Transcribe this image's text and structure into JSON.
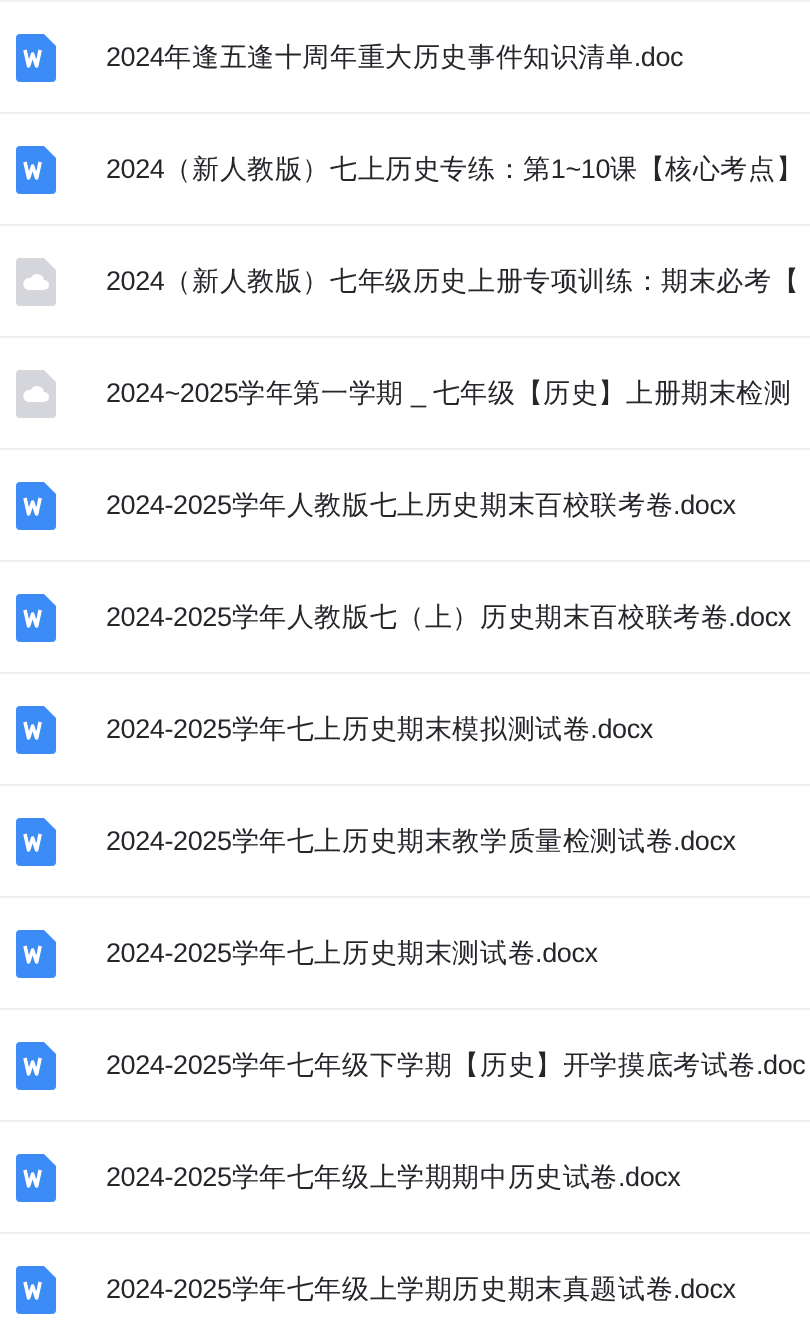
{
  "files": [
    {
      "kind": "word",
      "name": "2024年逢五逢十周年重大历史事件知识清单.doc"
    },
    {
      "kind": "word",
      "name": "2024（新人教版）七上历史专练：第1~10课【核心考点】"
    },
    {
      "kind": "cloud",
      "name": "2024（新人教版）七年级历史上册专项训练：期末必考【"
    },
    {
      "kind": "cloud",
      "name": "2024~2025学年第一学期 _ 七年级【历史】上册期末检测"
    },
    {
      "kind": "word",
      "name": "2024-2025学年人教版七上历史期末百校联考卷.docx"
    },
    {
      "kind": "word",
      "name": "2024-2025学年人教版七（上）历史期末百校联考卷.docx"
    },
    {
      "kind": "word",
      "name": "2024-2025学年七上历史期末模拟测试卷.docx"
    },
    {
      "kind": "word",
      "name": "2024-2025学年七上历史期末教学质量检测试卷.docx"
    },
    {
      "kind": "word",
      "name": "2024-2025学年七上历史期末测试卷.docx"
    },
    {
      "kind": "word",
      "name": "2024-2025学年七年级下学期【历史】开学摸底考试卷.doc"
    },
    {
      "kind": "word",
      "name": "2024-2025学年七年级上学期期中历史试卷.docx"
    },
    {
      "kind": "word",
      "name": "2024-2025学年七年级上学期历史期末真题试卷.docx"
    }
  ]
}
